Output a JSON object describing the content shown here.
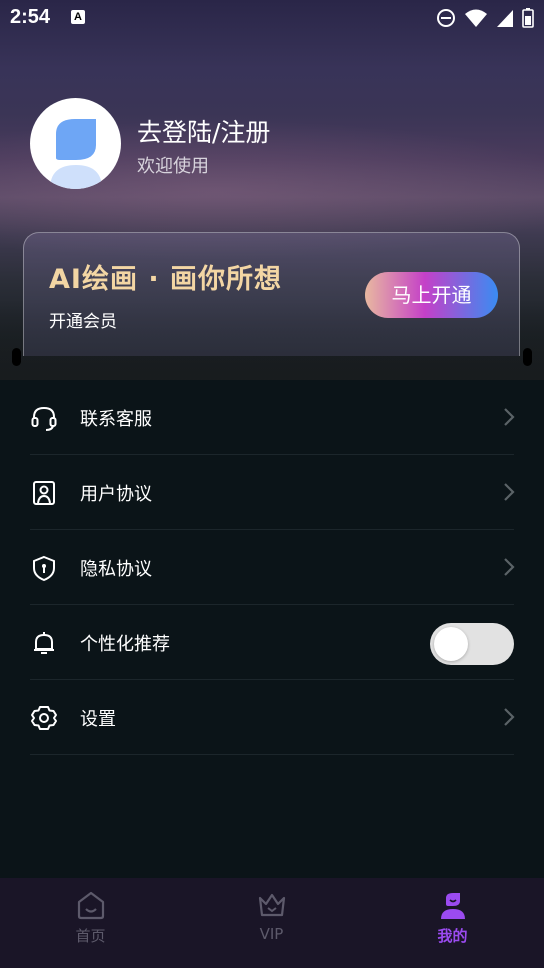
{
  "status_bar": {
    "time": "2:54",
    "notification_icon": "A"
  },
  "profile": {
    "title": "去登陆/注册",
    "subtitle": "欢迎使用"
  },
  "vip_card": {
    "title": "AI绘画 · 画你所想",
    "subtitle": "开通会员",
    "button_label": "马上开通"
  },
  "menu": [
    {
      "label": "联系客服",
      "icon": "headset-icon",
      "control": "chevron"
    },
    {
      "label": "用户协议",
      "icon": "user-agreement-icon",
      "control": "chevron"
    },
    {
      "label": "隐私协议",
      "icon": "privacy-shield-icon",
      "control": "chevron"
    },
    {
      "label": "个性化推荐",
      "icon": "bell-icon",
      "control": "toggle",
      "toggle_on": false
    },
    {
      "label": "设置",
      "icon": "settings-gear-icon",
      "control": "chevron"
    }
  ],
  "tabs": [
    {
      "label": "首页",
      "icon": "home-icon",
      "active": false
    },
    {
      "label": "VIP",
      "icon": "crown-icon",
      "active": false
    },
    {
      "label": "我的",
      "icon": "profile-icon",
      "active": true
    }
  ],
  "colors": {
    "accent": "#9b4bf0",
    "vip_title": "#f3d6a4",
    "background": "#0b1418",
    "tabbar": "#1a1527"
  }
}
